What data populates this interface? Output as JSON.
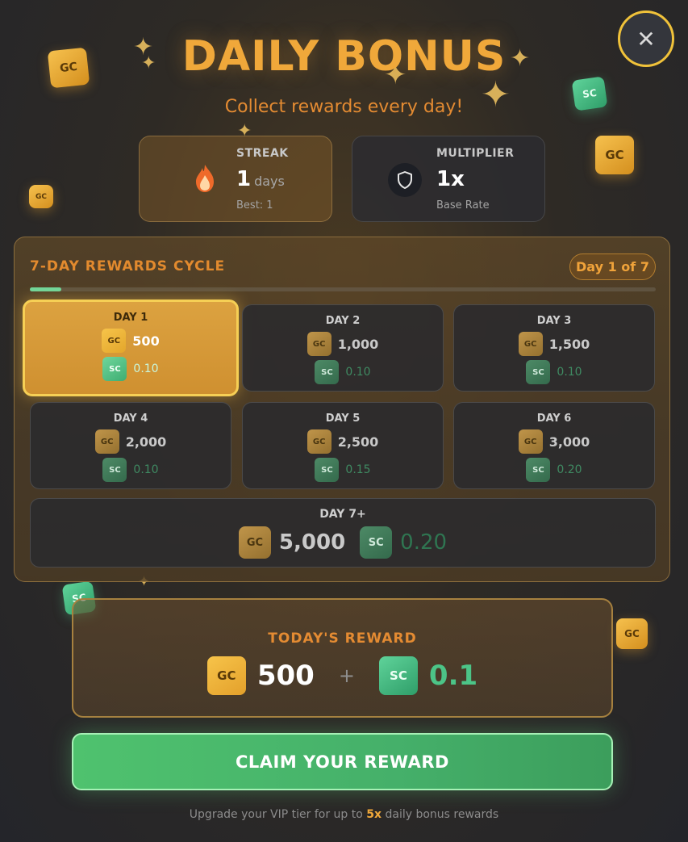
{
  "header": {
    "title": "DAILY BONUS",
    "subtitle": "Collect rewards every day!"
  },
  "close_button": {
    "glyph": "✕"
  },
  "streak": {
    "label": "STREAK",
    "value": "1",
    "unit": "days",
    "sub": "Best: 1",
    "icon": "flame-icon"
  },
  "multiplier": {
    "label": "MULTIPLIER",
    "value": "1x",
    "sub": "Base Rate",
    "icon": "shield-icon"
  },
  "cycle": {
    "title": "7-DAY REWARDS CYCLE",
    "badge": "Day 1 of 7",
    "progress": 0.05,
    "days": [
      {
        "label": "DAY 1",
        "gc": "500",
        "sc": "0.10",
        "active": true
      },
      {
        "label": "DAY 2",
        "gc": "1,000",
        "sc": "0.10",
        "active": false
      },
      {
        "label": "DAY 3",
        "gc": "1,500",
        "sc": "0.10",
        "active": false
      },
      {
        "label": "DAY 4",
        "gc": "2,000",
        "sc": "0.10",
        "active": false
      },
      {
        "label": "DAY 5",
        "gc": "2,500",
        "sc": "0.15",
        "active": false
      },
      {
        "label": "DAY 6",
        "gc": "3,000",
        "sc": "0.20",
        "active": false
      }
    ],
    "day7": {
      "label": "DAY 7+",
      "gc": "5,000",
      "sc": "0.20"
    }
  },
  "coins": {
    "gc": "GC",
    "sc": "SC"
  },
  "today": {
    "label": "TODAY'S REWARD",
    "gc": "500",
    "plus": "+",
    "sc": "0.1"
  },
  "claim_button": {
    "label": "CLAIM YOUR REWARD"
  },
  "footer": {
    "prefix": "Upgrade your VIP tier for up to",
    "highlight": "5x",
    "suffix": "daily bonus rewards"
  },
  "colors": {
    "accent_gold": "#f0a83a",
    "accent_orange": "#e48b32",
    "accent_green": "#4fc26e",
    "background": "#2e2a25"
  }
}
